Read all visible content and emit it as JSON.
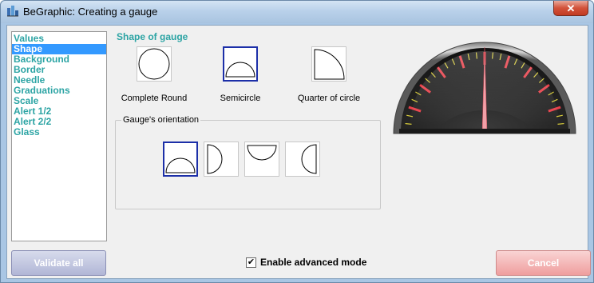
{
  "window": {
    "title": "BeGraphic: Creating a gauge"
  },
  "icons": {
    "app": "begraphic-app-icon",
    "close": "close-icon"
  },
  "sidebar": {
    "items": [
      {
        "label": "Values",
        "selected": false
      },
      {
        "label": "Shape",
        "selected": true
      },
      {
        "label": "Background",
        "selected": false
      },
      {
        "label": "Border",
        "selected": false
      },
      {
        "label": "Needle",
        "selected": false
      },
      {
        "label": "Graduations",
        "selected": false
      },
      {
        "label": "Scale",
        "selected": false
      },
      {
        "label": "Alert 1/2",
        "selected": false
      },
      {
        "label": "Alert 2/2",
        "selected": false
      },
      {
        "label": "Glass",
        "selected": false
      }
    ]
  },
  "shape": {
    "title": "Shape of gauge",
    "options": [
      {
        "label": "Complete Round",
        "icon": "circle-shape-icon",
        "selected": false
      },
      {
        "label": "Semicircle",
        "icon": "semicircle-shape-icon",
        "selected": true
      },
      {
        "label": "Quarter of circle",
        "icon": "quarter-circle-shape-icon",
        "selected": false
      }
    ]
  },
  "orientation": {
    "label": "Gauge's orientation",
    "options": [
      {
        "icon": "semicircle-up-icon",
        "selected": true
      },
      {
        "icon": "semicircle-right-icon",
        "selected": false
      },
      {
        "icon": "semicircle-down-icon",
        "selected": false
      },
      {
        "icon": "semicircle-left-icon",
        "selected": false
      }
    ]
  },
  "footer": {
    "validate_label": "Validate all",
    "advanced_label": "Enable advanced mode",
    "advanced_checked": true,
    "checkmark": "✔",
    "cancel_label": "Cancel"
  },
  "colors": {
    "accent_teal": "#2ca4a4",
    "selection_blue": "#3399ff",
    "selected_border": "#1c2fa8",
    "gauge_red": "#e8404a",
    "gauge_yellow": "#d8cc3a"
  }
}
